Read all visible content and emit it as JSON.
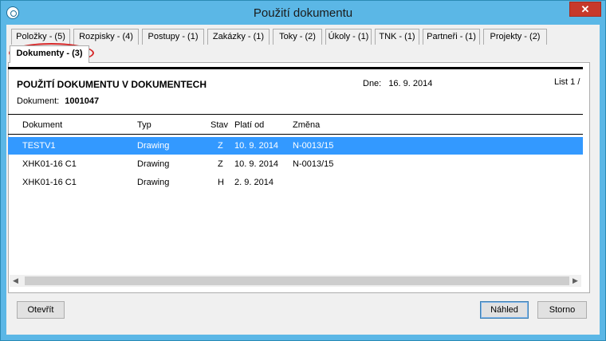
{
  "window": {
    "title": "Použití dokumentu",
    "close_label": "✕"
  },
  "tabs": [
    {
      "label": "Položky - (5)"
    },
    {
      "label": "Rozpisky - (4)"
    },
    {
      "label": "Postupy - (1)"
    },
    {
      "label": "Zakázky - (1)"
    },
    {
      "label": "Toky - (2)"
    },
    {
      "label": "Úkoly - (1)"
    },
    {
      "label": "TNK - (1)"
    },
    {
      "label": "Partneři - (1)"
    },
    {
      "label": "Projekty - (2)"
    },
    {
      "label": "Dokumenty - (3)"
    }
  ],
  "report": {
    "title": "POUŽITÍ DOKUMENTU V DOKUMENTECH",
    "date_label": "Dne:",
    "date_value": "16. 9. 2014",
    "page_label": "List 1 /",
    "document_label": "Dokument:",
    "document_value": "1001047"
  },
  "table": {
    "headers": [
      "Dokument",
      "Typ",
      "Stav",
      "Platí od",
      "Změna"
    ],
    "rows": [
      [
        "TESTV1",
        "Drawing",
        "Z",
        "10. 9. 2014",
        "N-0013/15"
      ],
      [
        "XHK01-16 C1",
        "Drawing",
        "Z",
        "10. 9. 2014",
        "N-0013/15"
      ],
      [
        "XHK01-16 C1",
        "Drawing",
        "H",
        "2. 9. 2014",
        ""
      ]
    ],
    "selected_row": 0
  },
  "buttons": {
    "open": "Otevřít",
    "preview": "Náhled",
    "cancel": "Storno"
  },
  "scroll_arrows": {
    "left": "◀",
    "right": "▶"
  },
  "colors": {
    "titlebar": "#5bb7e6",
    "selection": "#3399ff",
    "highlight_ellipse": "#d62728",
    "close_button": "#c7392b"
  }
}
